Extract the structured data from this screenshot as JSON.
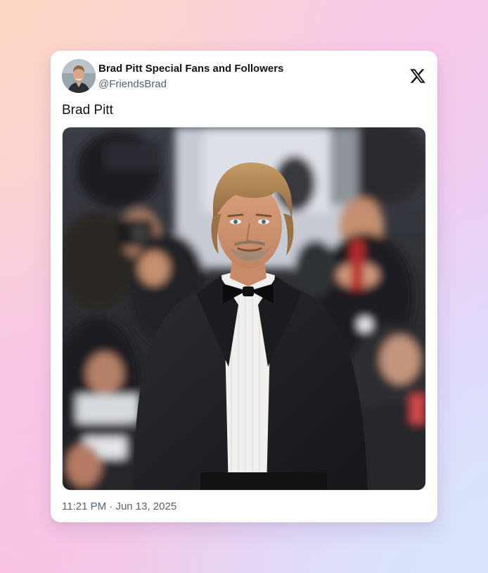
{
  "tweet": {
    "author": {
      "display_name": "Brad Pitt Special Fans and Followers",
      "handle": "@FriendsBrad",
      "avatar_icon": "profile-photo"
    },
    "text": "Brad Pitt",
    "media": {
      "icon": "photo-man-in-tuxedo-red-carpet"
    },
    "time": "11:21 PM",
    "separator": "·",
    "date": "Jun 13, 2025",
    "brand_icon": "x-logo-icon"
  },
  "colors": {
    "name": "#0f1419",
    "secondary": "#536471",
    "card": "#ffffff"
  }
}
